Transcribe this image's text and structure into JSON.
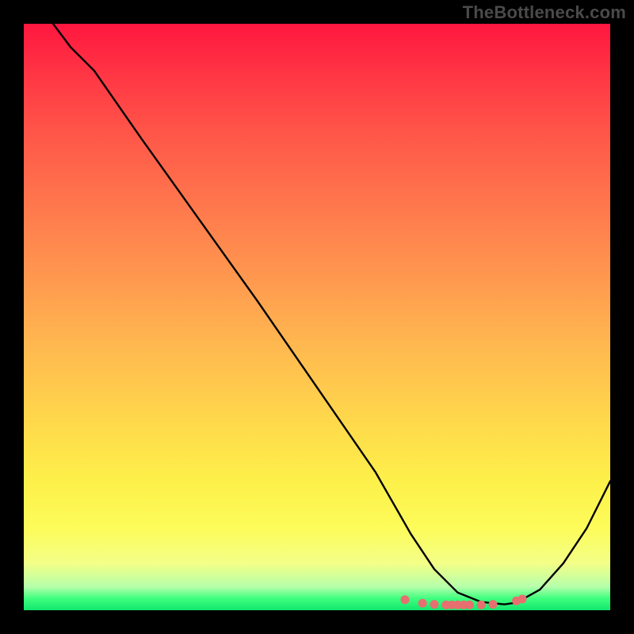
{
  "watermark": "TheBottleneck.com",
  "chart_data": {
    "type": "line",
    "title": "",
    "xlabel": "",
    "ylabel": "",
    "xlim": [
      0,
      100
    ],
    "ylim": [
      0,
      100
    ],
    "grid": false,
    "series": [
      {
        "name": "curve",
        "color": "#000000",
        "x": [
          5,
          8,
          12,
          20,
          30,
          40,
          50,
          60,
          66,
          70,
          74,
          78,
          82,
          84,
          88,
          92,
          96,
          100
        ],
        "y": [
          100,
          96,
          92,
          80.5,
          66.5,
          52.5,
          38,
          23.5,
          13,
          7,
          3,
          1.4,
          1,
          1.3,
          3.5,
          8,
          14,
          22
        ]
      },
      {
        "name": "bottom-markers",
        "color": "#e76f6f",
        "type": "scatter",
        "x": [
          65,
          68,
          70,
          72,
          73,
          74,
          75,
          76,
          78,
          80,
          84,
          85
        ],
        "y": [
          1.8,
          1.2,
          1.0,
          0.9,
          0.9,
          0.9,
          0.9,
          0.9,
          0.9,
          1.0,
          1.6,
          1.9
        ]
      }
    ],
    "background_gradient_stops": [
      {
        "pos": 0,
        "hex": "#ff173f"
      },
      {
        "pos": 10,
        "hex": "#ff3a45"
      },
      {
        "pos": 20,
        "hex": "#ff5a49"
      },
      {
        "pos": 32,
        "hex": "#ff7a4d"
      },
      {
        "pos": 44,
        "hex": "#ff9a4f"
      },
      {
        "pos": 56,
        "hex": "#ffbb4f"
      },
      {
        "pos": 68,
        "hex": "#ffd94b"
      },
      {
        "pos": 78,
        "hex": "#fdf04a"
      },
      {
        "pos": 86,
        "hex": "#fdfc5a"
      },
      {
        "pos": 92,
        "hex": "#f3ff87"
      },
      {
        "pos": 96,
        "hex": "#b6ffab"
      },
      {
        "pos": 98,
        "hex": "#3eff7e"
      },
      {
        "pos": 100,
        "hex": "#11e76e"
      }
    ]
  },
  "colors": {
    "frame_bg": "#000000",
    "curve": "#000000",
    "markers": "#e76f6f",
    "watermark": "#4a4a4a"
  }
}
